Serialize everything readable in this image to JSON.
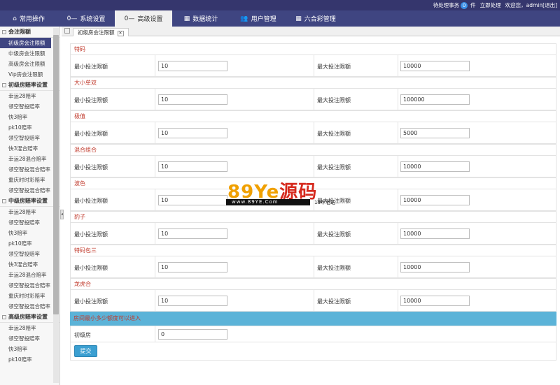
{
  "topbar": {
    "pending_label": "待处理事务",
    "pending_count": "0",
    "pending_unit": "件",
    "handle_now": "立即处理",
    "welcome": "欢迎您，admin",
    "logout": "[退出]"
  },
  "nav": [
    {
      "label": "常用操作",
      "icon": "home-icon"
    },
    {
      "label": "系统设置",
      "icon": "key-icon"
    },
    {
      "label": "高级设置",
      "icon": "key-icon"
    },
    {
      "label": "数据统计",
      "icon": "grid-icon"
    },
    {
      "label": "用户管理",
      "icon": "users-icon"
    },
    {
      "label": "六合彩管理",
      "icon": "grid-icon"
    }
  ],
  "sidebar": {
    "groups": [
      {
        "title": "会注限额",
        "items": [
          "初级房会注限额",
          "中级房会注限额",
          "高级房会注限额",
          "Vip房会注限额"
        ]
      },
      {
        "title": "初级房赔率设置",
        "items": [
          "幸运28赔率",
          "领空智投赔率",
          "快3赔率",
          "pk10赔率",
          "领空智投赔率",
          "快3混合赔率",
          "幸运28混合赔率",
          "领空智投混合赔率",
          "重庆时时彩赔率",
          "领空智投混合赔率"
        ]
      },
      {
        "title": "中级房赔率设置",
        "items": [
          "幸运28赔率",
          "领空智投赔率",
          "快3赔率",
          "pk10赔率",
          "领空智投赔率",
          "快3混合赔率",
          "幸运28混合赔率",
          "领空智投混合赔率",
          "重庆时时彩赔率",
          "领空智投混合赔率"
        ]
      },
      {
        "title": "高级房赔率设置",
        "items": [
          "幸运28赔率",
          "领空智投赔率",
          "快3赔率",
          "pk10赔率"
        ]
      }
    ]
  },
  "tab": {
    "label": "初级房会注限额"
  },
  "form": {
    "min_label": "最小投注限额",
    "max_label": "最大投注限额",
    "sections": [
      {
        "title": "特码",
        "min": "10",
        "max": "10000"
      },
      {
        "title": "大小单双",
        "min": "10",
        "max": "100000"
      },
      {
        "title": "极值",
        "min": "10",
        "max": "5000"
      },
      {
        "title": "混合组合",
        "min": "10",
        "max": "10000"
      },
      {
        "title": "波色",
        "min": "10",
        "max": "10000"
      },
      {
        "title": "豹子",
        "min": "10",
        "max": "10000"
      },
      {
        "title": "特码包三",
        "min": "10",
        "max": "10000"
      },
      {
        "title": "龙虎合",
        "min": "10",
        "max": "10000"
      }
    ],
    "entry_title": "房间最小多少额度可以进入",
    "entry_label": "初级房",
    "entry_value": "0",
    "submit": "提交"
  },
  "watermark": {
    "brand_num": "89",
    "brand_ye": "Ye",
    "brand_cn": "源码",
    "site": "www.89YE.Com",
    "tag": "10年老站"
  }
}
